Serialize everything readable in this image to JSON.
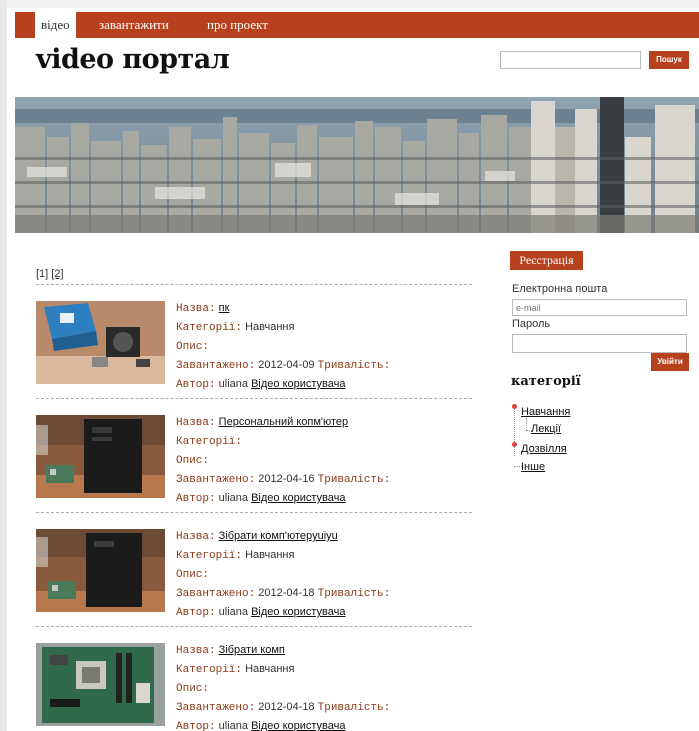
{
  "nav": {
    "items": [
      {
        "label": "відео",
        "active": true
      },
      {
        "label": "завантажити",
        "active": false
      },
      {
        "label": "про проект",
        "active": false
      }
    ]
  },
  "site": {
    "title": "video портал"
  },
  "search": {
    "value": "",
    "button_label": "Пошук"
  },
  "pager": {
    "page1": "[1]",
    "page2": "[2]"
  },
  "labels": {
    "name": "Назва:",
    "categories": "Категорії:",
    "description": "Опис:",
    "uploaded": "Завантажено:",
    "duration": "Тривалість:",
    "author": "Автор:"
  },
  "videos": [
    {
      "title": "пк",
      "category": "Навчання",
      "date": "2012-04-09",
      "author": "uliana",
      "author_link": "Відео користувача",
      "thumb": "boxed-computer-parts"
    },
    {
      "title": "Персональний копм'ютер",
      "category": "",
      "date": "2012-04-16",
      "author": "uliana",
      "author_link": "Відео користувача",
      "thumb": "pc-tower"
    },
    {
      "title": "Зібрати комп'ютерyuiyu",
      "category": "Навчання",
      "date": "2012-04-18",
      "author": "uliana",
      "author_link": "Відео користувача",
      "thumb": "pc-tower"
    },
    {
      "title": "Зібрати комп",
      "category": "Навчання",
      "date": "2012-04-18",
      "author": "uliana",
      "author_link": "Відео користувача",
      "thumb": "motherboard"
    }
  ],
  "sidebar": {
    "register_label": "Реєстрація",
    "email_label": "Електронна пошта",
    "email_placeholder": "e-mail",
    "password_label": "Пароль",
    "login_label": "Увійти",
    "categories_title": "категорії",
    "categories": [
      {
        "label": "Навчання",
        "children": [
          {
            "label": "Лекції"
          }
        ]
      },
      {
        "label": "Дозвілля",
        "children": []
      },
      {
        "label": "Інше",
        "children": []
      }
    ]
  },
  "colors": {
    "accent": "#b7411d",
    "label": "#8b3a18"
  }
}
